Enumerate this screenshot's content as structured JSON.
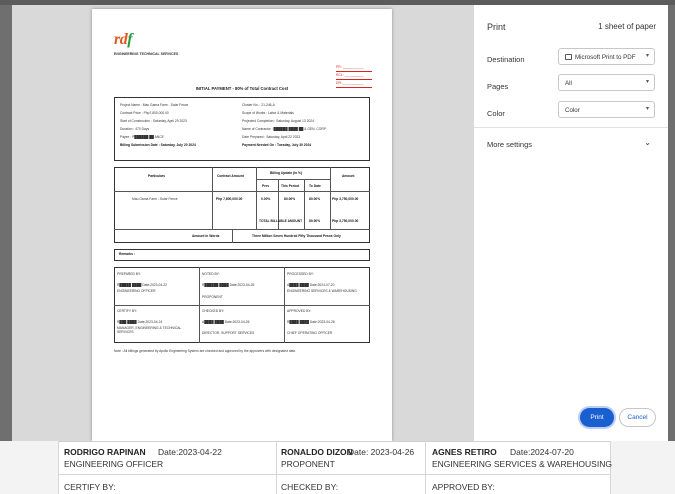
{
  "dialog": {
    "title": "Print",
    "sheet_count": "1 sheet of paper",
    "destination_label": "Destination",
    "destination_value": "Microsoft Print to PDF",
    "pages_label": "Pages",
    "pages_value": "All",
    "color_label": "Color",
    "color_value": "Color",
    "more_settings": "More settings",
    "print_button": "Print",
    "cancel_button": "Cancel"
  },
  "preview": {
    "logo_r": "r",
    "logo_d": "d",
    "logo_f": "f",
    "logo_subtitle": "ENGINEERING TECHNICAL SERVICES",
    "refs": [
      "PR: ___________",
      "RCL: __________",
      "DR: ___________"
    ],
    "title": "INITIAL PAYMENT - 80% of Total Contract Cost",
    "info": {
      "project_name": "Project Name : Mau Gama Farm - Solar Fence",
      "contract_price": "Contract Price : Php7,800,000.00",
      "start": "Start of Construction : Saturday, April 29 2023",
      "duration": "Duration : 470 Days",
      "payee": "Payee : P██████ ██ ANCE",
      "billing_date": "Billing Submission Date : Saturday, July 20 2024",
      "cluster": "Cluster No. : 21-246-A",
      "scope": "Scope of Works : Labor & Materials",
      "completion": "Projected Completion : Saturday, August 13 2024",
      "contractor": "Name of Contractor : ██████ ████ ██ & GEN. CORP",
      "date_prepared": "Date Prepared : Saturday, April 22 2023",
      "payment_needed": "Payment Needed On : Tuesday, July 30 2024"
    },
    "table": {
      "headers": [
        "Particulars",
        "Contract Amount",
        "Billing Update (in %)",
        "Amount"
      ],
      "subheaders": [
        "Prev",
        "This Period",
        "To Date"
      ],
      "row": [
        "Mau Gama Farm - Solar Fence",
        "Php 7,800,000.00",
        "0.00%",
        "80.00%",
        "80.00%",
        "Php 3,750,000.00"
      ],
      "total_label": "TOTAL BILLABLE AMOUNT",
      "total_pct": "80.00%",
      "total_amount": "Php 3,750,000.00",
      "words_label": "Amount in Words",
      "words_value": "Three Million Seven Hundred Fifty Thousand Pesos Only"
    },
    "remarks": "Remarks :",
    "sign": {
      "prepared_by": "PREPARED BY:",
      "noted_by": "NOTED BY:",
      "processed_by": "PROCESSED BY:",
      "certify_by": "CERTIFY BY:",
      "checked_by": "CHECKED BY:",
      "approved_by": "APPROVED BY:",
      "p1_name": "R█████ ████ Date:2023-04-22",
      "p1_role": "ENGINEERING OFFICER",
      "p2_name": "R██████ ████ Date:2023-04-26",
      "p2_role": "PROPONENT",
      "p3_name": "A████ ████ Date:2024-07-20",
      "p3_role": "ENGINEERING SERVICES & WAREHOUSING",
      "c1_name": "R███ ████ Date:2023-04-24",
      "c1_role": "MANAGER, ENGINEERING & TECHNICAL SERVICES",
      "c2_name": "A████ ████ Date:2023-04-26",
      "c2_role": "DIRECTOR, SUPPORT SERVICES",
      "c3_name": "R████ ████ Date:2023-04-26",
      "c3_role": "CHIEF OPERATING OFFICER"
    },
    "note": "Note : All billings generated by Apollo Engineering System are checked and approved by the approvers with designated date."
  },
  "background": {
    "cells": [
      {
        "name": "RODRIGO RAPINAN",
        "date": "Date:2023-04-22",
        "role": "ENGINEERING OFFICER"
      },
      {
        "name": "RONALDO DIZON",
        "date": "Date: 2023-04-26",
        "role": "PROPONENT"
      },
      {
        "name": "AGNES RETIRO",
        "date": "Date:2024-07-20",
        "role": "ENGINEERING SERVICES & WAREHOUSING"
      }
    ],
    "labels": [
      "CERTIFY BY:",
      "CHECKED BY:",
      "APPROVED BY:"
    ]
  }
}
